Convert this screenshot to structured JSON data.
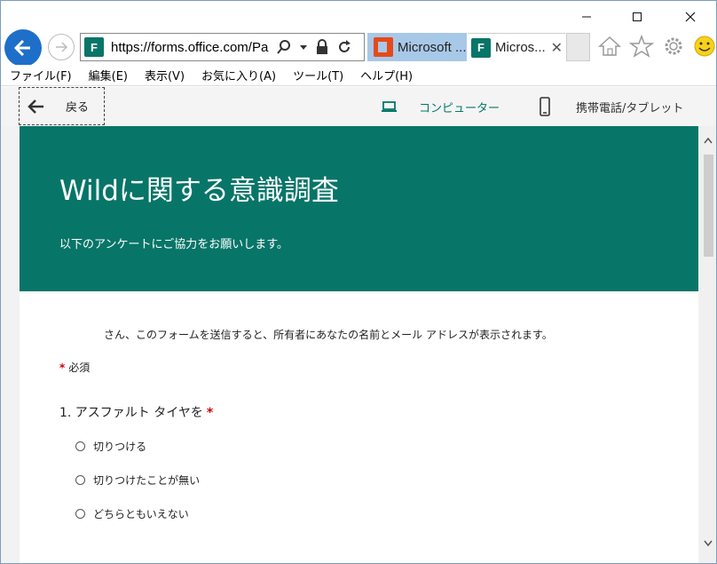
{
  "browser": {
    "url": "https://forms.office.com/Pa",
    "tabs": [
      {
        "label": "Microsoft ...",
        "icon": "office-icon"
      },
      {
        "label": "Micros...",
        "icon": "forms-icon",
        "active": true
      }
    ],
    "favicon_letter": "F",
    "menu": [
      "ファイル(F)",
      "編集(E)",
      "表示(V)",
      "お気に入り(A)",
      "ツール(T)",
      "ヘルプ(H)"
    ]
  },
  "formnav": {
    "back_label": "戻る",
    "computer_label": "コンピューター",
    "mobile_label": "携帯電話/タブレット"
  },
  "form": {
    "title": "Wildに関する意識調査",
    "subtitle": "以下のアンケートにご協力をお願いします。",
    "notice": "さん、このフォームを送信すると、所有者にあなたの名前とメール アドレスが表示されます。",
    "required_mark": "*",
    "required_label": "必須",
    "question": {
      "number_text": "1. アスファルト タイヤを",
      "required_mark": "*",
      "options": [
        "切りつける",
        "切りつけたことが無い",
        "どちらともいえない"
      ]
    }
  },
  "colors": {
    "accent": "#077568",
    "browser_blue": "#1e6fc9",
    "required": "#cc0000"
  }
}
